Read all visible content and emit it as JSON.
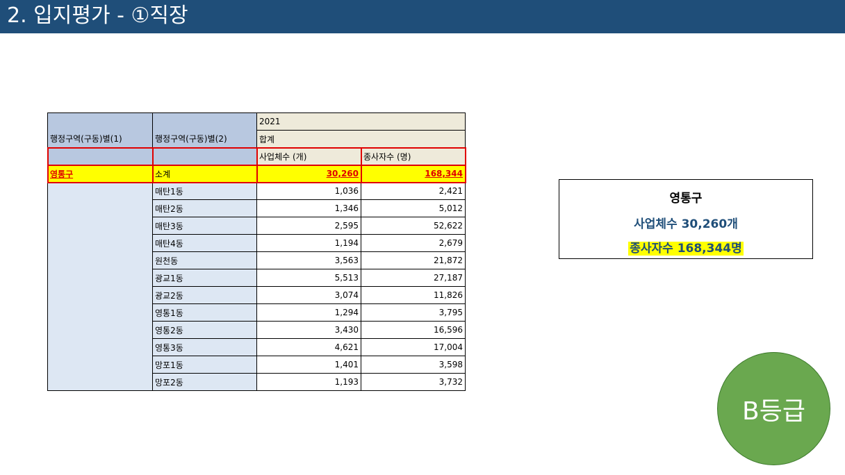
{
  "header": {
    "title": "2. 입지평가 - ①직장"
  },
  "table": {
    "col1_header": "행정구역(구동)별(1)",
    "col2_header": "행정구역(구동)별(2)",
    "year": "2021",
    "total_label": "합계",
    "metric1_header": "사업체수 (개)",
    "metric2_header": "종사자수 (명)",
    "district": "영통구",
    "subtotal_label": "소계",
    "subtotal_businesses": "30,260",
    "subtotal_employees": "168,344",
    "rows": [
      {
        "dong": "매탄1동",
        "businesses": "1,036",
        "employees": "2,421"
      },
      {
        "dong": "매탄2동",
        "businesses": "1,346",
        "employees": "5,012"
      },
      {
        "dong": "매탄3동",
        "businesses": "2,595",
        "employees": "52,622"
      },
      {
        "dong": "매탄4동",
        "businesses": "1,194",
        "employees": "2,679"
      },
      {
        "dong": "원천동",
        "businesses": "3,563",
        "employees": "21,872"
      },
      {
        "dong": "광교1동",
        "businesses": "5,513",
        "employees": "27,187"
      },
      {
        "dong": "광교2동",
        "businesses": "3,074",
        "employees": "11,826"
      },
      {
        "dong": "영통1동",
        "businesses": "1,294",
        "employees": "3,795"
      },
      {
        "dong": "영통2동",
        "businesses": "3,430",
        "employees": "16,596"
      },
      {
        "dong": "영통3동",
        "businesses": "4,621",
        "employees": "17,004"
      },
      {
        "dong": "망포1동",
        "businesses": "1,401",
        "employees": "3,598"
      },
      {
        "dong": "망포2동",
        "businesses": "1,193",
        "employees": "3,732"
      }
    ]
  },
  "summary": {
    "district": "영통구",
    "businesses": "사업체수  30,260개",
    "employees": "종사자수  168,344명"
  },
  "grade": {
    "label": "B등급"
  },
  "colors": {
    "header_bg": "#1f4e79",
    "highlight": "#ffff00",
    "accent_red": "#e00000",
    "grade_green": "#6aa84f"
  }
}
